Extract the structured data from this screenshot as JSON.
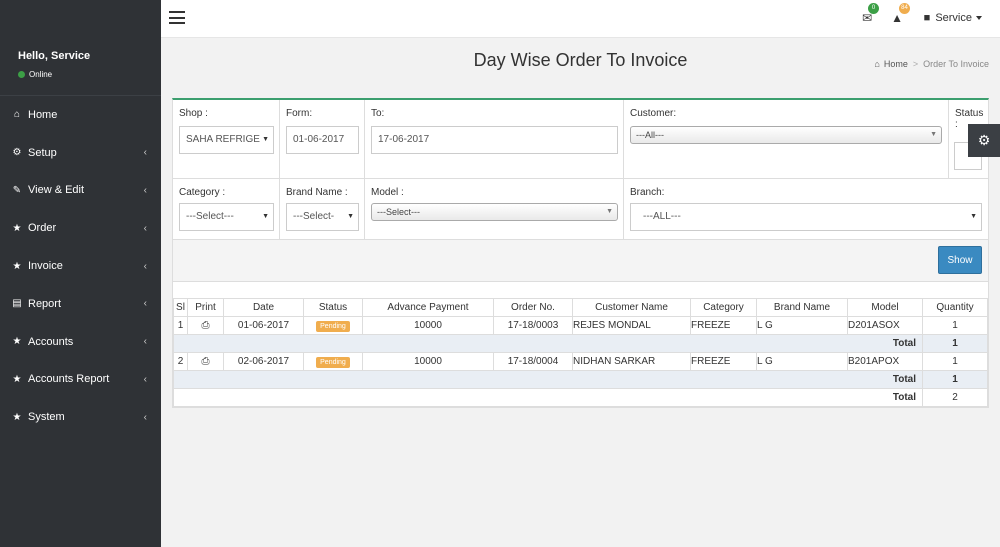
{
  "sidebar": {
    "greeting": "Hello, Service",
    "status": "Online",
    "items": [
      {
        "label": "Home",
        "icon": "home-icon",
        "chev": ""
      },
      {
        "label": "Setup",
        "icon": "cogs-icon",
        "chev": "‹"
      },
      {
        "label": "View & Edit",
        "icon": "edit-icon",
        "chev": "‹"
      },
      {
        "label": "Order",
        "icon": "star-icon",
        "chev": "‹"
      },
      {
        "label": "Invoice",
        "icon": "star-icon",
        "chev": "‹"
      },
      {
        "label": "Report",
        "icon": "file-icon",
        "chev": "‹"
      },
      {
        "label": "Accounts",
        "icon": "star-icon",
        "chev": "‹"
      },
      {
        "label": "Accounts Report",
        "icon": "star-icon",
        "chev": "‹"
      },
      {
        "label": "System",
        "icon": "star-icon",
        "chev": "‹"
      }
    ]
  },
  "header": {
    "mail_badge": "0",
    "alert_badge": "84",
    "user": "Service"
  },
  "page": {
    "title": "Day Wise Order To Invoice",
    "breadcrumb_home": "Home",
    "breadcrumb_current": "Order To Invoice"
  },
  "filters": {
    "shop_label": "Shop :",
    "shop_value": "SAHA REFRIGE",
    "from_label": "Form:",
    "from_value": "01-06-2017",
    "to_label": "To:",
    "to_value": "17-06-2017",
    "customer_label": "Customer:",
    "customer_value": "---All---",
    "status_label": "Status",
    "status_colon": ":",
    "category_label": "Category :",
    "category_value": "---Select---",
    "brand_label": "Brand Name :",
    "brand_value": "---Select-",
    "model_label": "Model :",
    "model_value": "---Select---",
    "branch_label": "Branch:",
    "branch_value": "---ALL---",
    "show_button": "Show"
  },
  "table": {
    "headers": [
      "Sl",
      "Print",
      "Date",
      "Status",
      "Advance Payment",
      "Order No.",
      "Customer Name",
      "Category",
      "Brand Name",
      "Model",
      "Quantity"
    ],
    "rows": [
      {
        "sl": "1",
        "date": "01-06-2017",
        "status": "Pending",
        "advance": "10000",
        "order_no": "17-18/0003",
        "customer": "REJES MONDAL",
        "category": "FREEZE",
        "brand": "L G",
        "model": "D201ASOX",
        "qty": "1",
        "subtotal_label": "Total",
        "subtotal": "1"
      },
      {
        "sl": "2",
        "date": "02-06-2017",
        "status": "Pending",
        "advance": "10000",
        "order_no": "17-18/0004",
        "customer": "NIDHAN SARKAR",
        "category": "FREEZE",
        "brand": "L G",
        "model": "B201APOX",
        "qty": "1",
        "subtotal_label": "Total",
        "subtotal": "1"
      }
    ],
    "grand_total_label": "Total",
    "grand_total": "2"
  },
  "colors": {
    "sidebar_bg": "#2f3236",
    "accent_green": "#3c9f6f",
    "button_blue": "#3a8ac1",
    "pending_orange": "#f0ad4e",
    "mail_badge": "#3c9f46",
    "alert_badge": "#f0ad4e"
  }
}
